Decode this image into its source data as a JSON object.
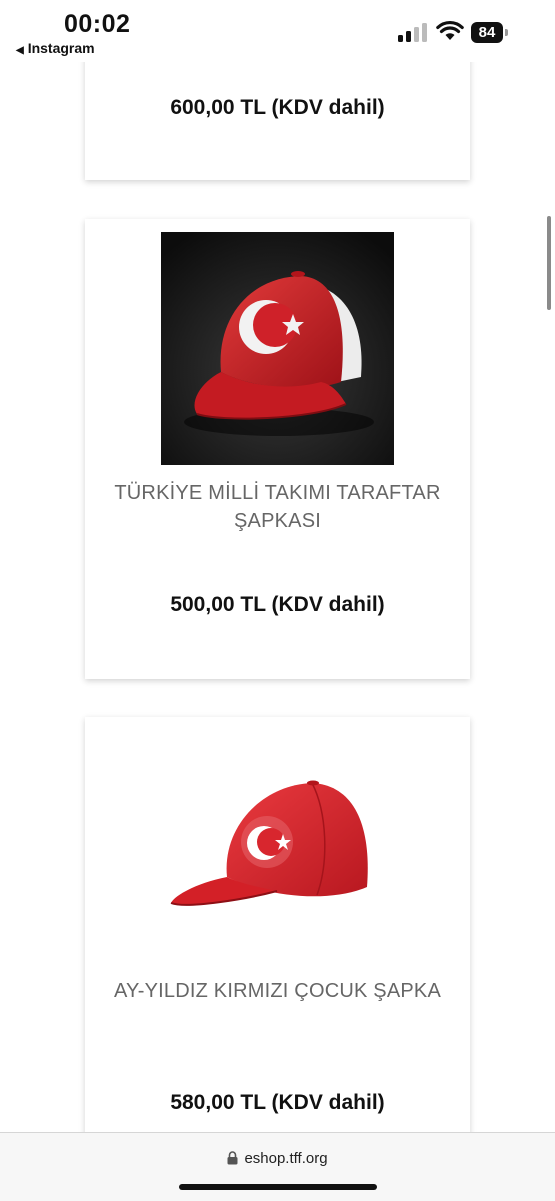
{
  "status_bar": {
    "time": "00:02",
    "back_app": "Instagram",
    "battery_level": "84"
  },
  "products": [
    {
      "price": "600,00 TL (KDV dahil)"
    },
    {
      "name_line1": "TÜRKİYE MİLLİ TAKIMI TARAFTAR",
      "name_line2": "ŞAPKASI",
      "price": "500,00 TL (KDV dahil)",
      "image_icon": "cap-icon"
    },
    {
      "name_line1": "AY-YILDIZ KIRMIZI ÇOCUK ŞAPKA",
      "price": "580,00 TL (KDV dahil)",
      "image_icon": "cap-icon"
    }
  ],
  "browser": {
    "url": "eshop.tff.org"
  },
  "colors": {
    "cap_red": "#d7202b",
    "name_gray": "#666666"
  }
}
